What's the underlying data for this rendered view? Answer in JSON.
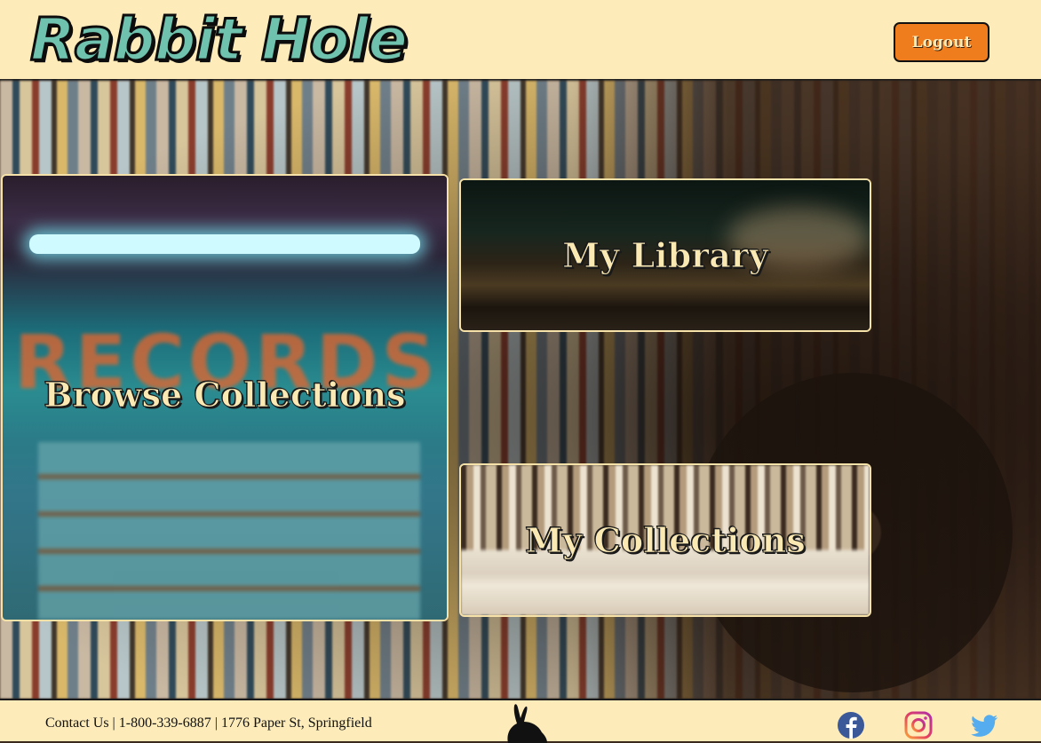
{
  "header": {
    "logo_text": "Rabbit Hole",
    "logout_label": "Logout"
  },
  "cards": {
    "browse": {
      "title": "Browse Collections",
      "sign_text": "RECORDS"
    },
    "library": {
      "title": "My Library"
    },
    "collections": {
      "title": "My Collections"
    }
  },
  "footer": {
    "contact_label": "Contact Us",
    "phone": "1-800-339-6887",
    "address": "1776 Paper St, Springfield",
    "separator": "|",
    "social": [
      "facebook-icon",
      "instagram-icon",
      "twitter-icon"
    ]
  },
  "colors": {
    "header_bg": "#fdebb9",
    "accent": "#6fc2ad",
    "logout_bg": "#ef7d1d",
    "card_border": "#f6e2a8",
    "facebook": "#3b5998",
    "twitter": "#55acee"
  }
}
